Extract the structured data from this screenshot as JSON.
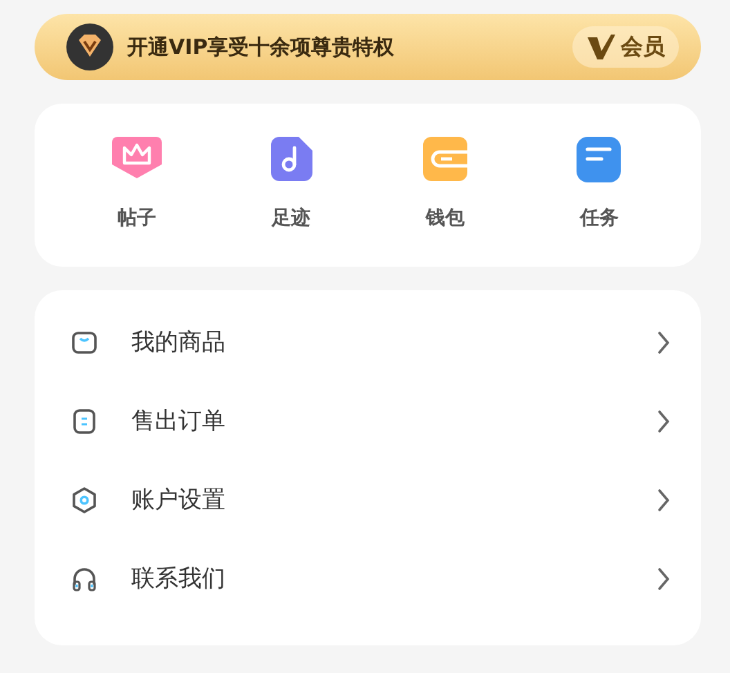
{
  "vip_banner": {
    "text": "开通VIP享受十余项尊贵特权",
    "badge_label": "会员"
  },
  "shortcuts": [
    {
      "label": "帖子"
    },
    {
      "label": "足迹"
    },
    {
      "label": "钱包"
    },
    {
      "label": "任务"
    }
  ],
  "menu": [
    {
      "label": "我的商品"
    },
    {
      "label": "售出订单"
    },
    {
      "label": "账户设置"
    },
    {
      "label": "联系我们"
    }
  ]
}
